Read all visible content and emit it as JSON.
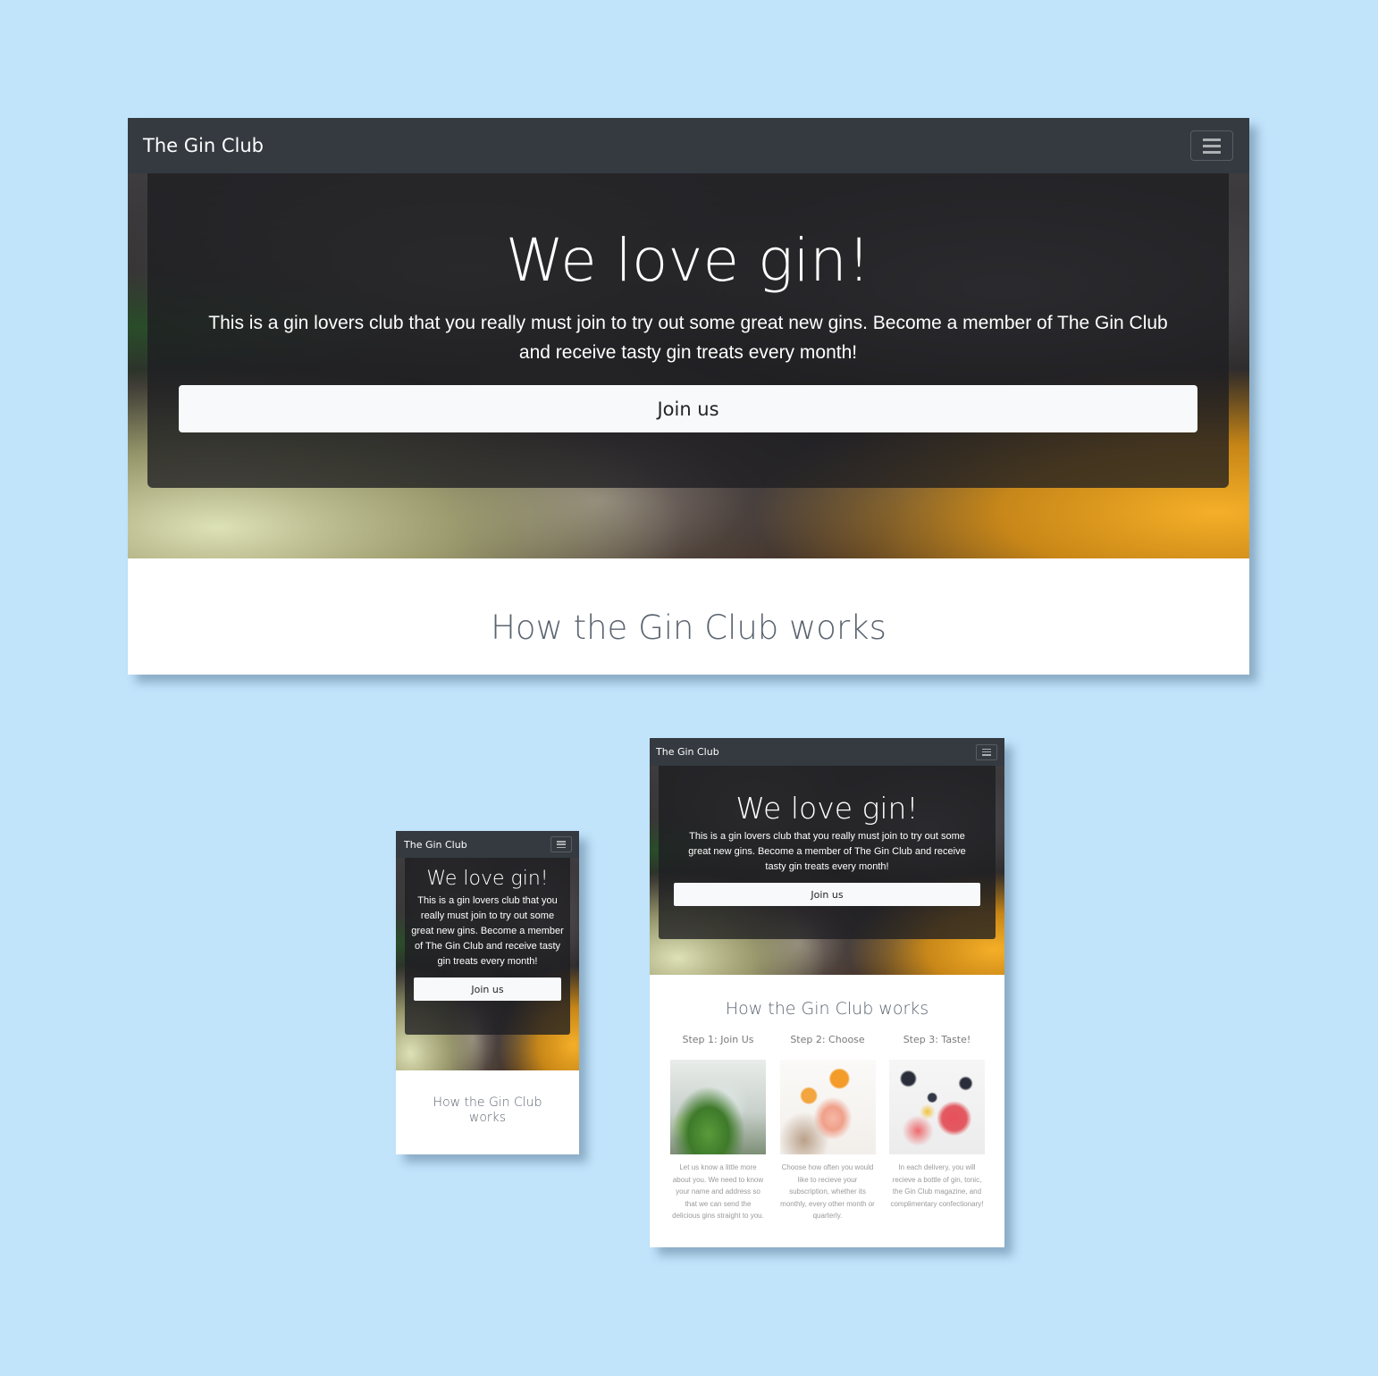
{
  "brand": "The Gin Club",
  "hero": {
    "title": "We love gin!",
    "text": "This is a gin lovers club that you really must join to try out some great new gins. Become a member of The Gin Club and receive tasty gin treats every month!",
    "button": "Join us"
  },
  "works": {
    "title": "How the Gin Club works",
    "steps": [
      {
        "title": "Step 1: Join Us",
        "text": "Let us know a little more about you. We need to know your name and address so that we can send the delicious gins straight to you.",
        "image": "gin-cucumber-glass-image"
      },
      {
        "title": "Step 2: Choose",
        "text": "Choose how often you would like to recieve your subscription, whether its monthly, every other month or quarterly.",
        "image": "orange-cocktail-image"
      },
      {
        "title": "Step 3: Taste!",
        "text": "In each delivery, you will recieve a bottle of gin, tonic, the Gin Club magazine, and complimentary confectionary!",
        "image": "berries-cocktail-image"
      }
    ]
  },
  "colors": {
    "background": "#c1e4fb",
    "navbar": "#343a40",
    "button": "#f8f9fa"
  }
}
